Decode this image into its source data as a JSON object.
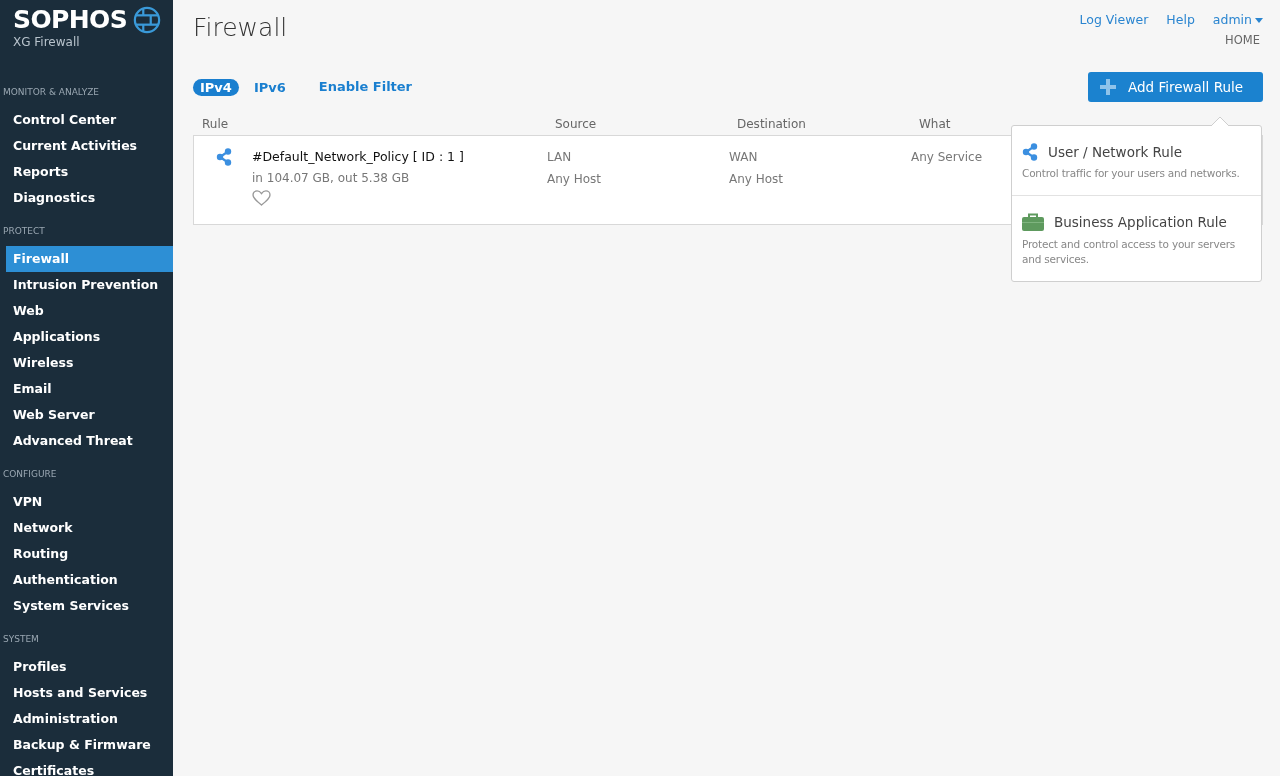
{
  "brand": {
    "name": "SOPHOS",
    "product": "XG Firewall"
  },
  "sidebar": {
    "sections": [
      {
        "title": "MONITOR & ANALYZE",
        "items": [
          {
            "label": "Control Center",
            "selected": false
          },
          {
            "label": "Current Activities",
            "selected": false
          },
          {
            "label": "Reports",
            "selected": false
          },
          {
            "label": "Diagnostics",
            "selected": false
          }
        ]
      },
      {
        "title": "PROTECT",
        "items": [
          {
            "label": "Firewall",
            "selected": true
          },
          {
            "label": "Intrusion Prevention",
            "selected": false
          },
          {
            "label": "Web",
            "selected": false
          },
          {
            "label": "Applications",
            "selected": false
          },
          {
            "label": "Wireless",
            "selected": false
          },
          {
            "label": "Email",
            "selected": false
          },
          {
            "label": "Web Server",
            "selected": false
          },
          {
            "label": "Advanced Threat",
            "selected": false
          }
        ]
      },
      {
        "title": "CONFIGURE",
        "items": [
          {
            "label": "VPN",
            "selected": false
          },
          {
            "label": "Network",
            "selected": false
          },
          {
            "label": "Routing",
            "selected": false
          },
          {
            "label": "Authentication",
            "selected": false
          },
          {
            "label": "System Services",
            "selected": false
          }
        ]
      },
      {
        "title": "SYSTEM",
        "items": [
          {
            "label": "Profiles",
            "selected": false
          },
          {
            "label": "Hosts and Services",
            "selected": false
          },
          {
            "label": "Administration",
            "selected": false
          },
          {
            "label": "Backup & Firmware",
            "selected": false
          },
          {
            "label": "Certificates",
            "selected": false
          }
        ]
      }
    ]
  },
  "header": {
    "title": "Firewall",
    "links": [
      "Log Viewer",
      "Help"
    ],
    "user": "admin",
    "location": "HOME"
  },
  "ip_tabs": [
    {
      "label": "IPv4",
      "selected": true
    },
    {
      "label": "IPv6",
      "selected": false
    }
  ],
  "filter_link": "Enable Filter",
  "add_button": "Add Firewall Rule",
  "table": {
    "columns": [
      "Rule",
      "Source",
      "Destination",
      "What"
    ],
    "rows": [
      {
        "name": "#Default_Network_Policy [ ID : 1 ]",
        "traffic": "in 104.07 GB, out 5.38 GB",
        "favorite": false,
        "source": [
          "LAN",
          "Any Host"
        ],
        "destination": [
          "WAN",
          "Any Host"
        ],
        "what": "Any Service"
      }
    ]
  },
  "dropdown": {
    "items": [
      {
        "kind": "network",
        "title": "User / Network Rule",
        "description": "Control traffic for your users and networks."
      },
      {
        "kind": "business",
        "title": "Business Application Rule",
        "description": "Protect and control access to your servers and services."
      }
    ]
  }
}
